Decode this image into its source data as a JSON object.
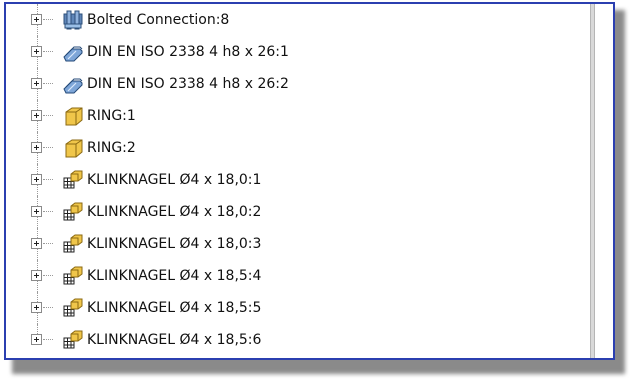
{
  "panel": {
    "border_color": "#2b3fb0"
  },
  "tree": {
    "items": [
      {
        "label": "Bolted Connection:8",
        "icon": "bolted-connection-icon"
      },
      {
        "label": "DIN EN ISO 2338 4 h8 x 26:1",
        "icon": "pin-part-icon"
      },
      {
        "label": "DIN EN ISO 2338 4 h8 x 26:2",
        "icon": "pin-part-icon"
      },
      {
        "label": "RING:1",
        "icon": "part-box-icon"
      },
      {
        "label": "RING:2",
        "icon": "part-box-icon"
      },
      {
        "label": "KLINKNAGEL Ø4 x 18,0:1",
        "icon": "assembly-part-icon"
      },
      {
        "label": "KLINKNAGEL Ø4 x 18,0:2",
        "icon": "assembly-part-icon"
      },
      {
        "label": "KLINKNAGEL Ø4 x 18,0:3",
        "icon": "assembly-part-icon"
      },
      {
        "label": "KLINKNAGEL Ø4 x 18,5:4",
        "icon": "assembly-part-icon"
      },
      {
        "label": "KLINKNAGEL Ø4 x 18,5:5",
        "icon": "assembly-part-icon"
      },
      {
        "label": "KLINKNAGEL Ø4 x 18,5:6",
        "icon": "assembly-part-icon"
      }
    ]
  }
}
